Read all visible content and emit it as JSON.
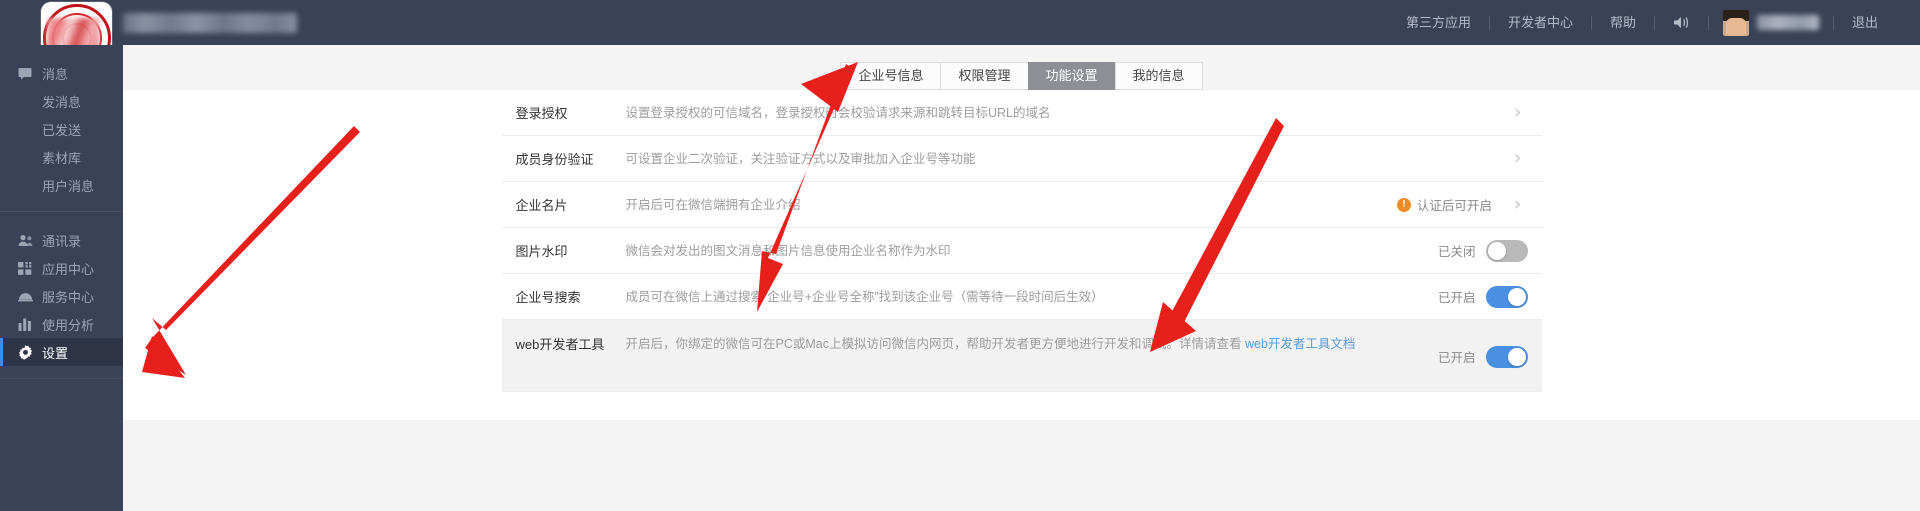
{
  "header": {
    "brand_title_redacted": "",
    "logo_alt": "company-seal-logo",
    "nav": [
      {
        "label": "第三方应用",
        "name": "nav-third-party-apps"
      },
      {
        "label": "开发者中心",
        "name": "nav-developer-center"
      },
      {
        "label": "帮助",
        "name": "nav-help"
      }
    ],
    "sound_icon": "speaker-icon",
    "user_name_redacted": "",
    "logout_label": "退出"
  },
  "sidebar": {
    "groups": [
      {
        "items": [
          {
            "label": "消息",
            "icon": "message-icon",
            "name": "sidebar-item-messages",
            "active": false
          }
        ],
        "subitems": [
          {
            "label": "发消息",
            "name": "sidebar-subitem-send-message"
          },
          {
            "label": "已发送",
            "name": "sidebar-subitem-sent"
          },
          {
            "label": "素材库",
            "name": "sidebar-subitem-material-library"
          },
          {
            "label": "用户消息",
            "name": "sidebar-subitem-user-messages"
          }
        ]
      },
      {
        "items": [
          {
            "label": "通讯录",
            "icon": "contacts-icon",
            "name": "sidebar-item-contacts",
            "active": false
          },
          {
            "label": "应用中心",
            "icon": "apps-grid-icon",
            "name": "sidebar-item-app-center",
            "active": false
          },
          {
            "label": "服务中心",
            "icon": "service-bell-icon",
            "name": "sidebar-item-service-center",
            "active": false
          },
          {
            "label": "使用分析",
            "icon": "bar-chart-icon",
            "name": "sidebar-item-analytics",
            "active": false
          },
          {
            "label": "设置",
            "icon": "gear-icon",
            "name": "sidebar-item-settings",
            "active": true
          }
        ],
        "subitems": []
      }
    ]
  },
  "tabs": [
    {
      "label": "企业号信息",
      "name": "tab-enterprise-info",
      "active": false
    },
    {
      "label": "权限管理",
      "name": "tab-permission-management",
      "active": false
    },
    {
      "label": "功能设置",
      "name": "tab-function-settings",
      "active": true
    },
    {
      "label": "我的信息",
      "name": "tab-my-info",
      "active": false
    }
  ],
  "settings_rows": [
    {
      "label": "登录授权",
      "desc": "设置登录授权的可信域名，登录授权时会校验请求来源和跳转目标URL的域名",
      "control": "chevron",
      "chevron": "›"
    },
    {
      "label": "成员身份验证",
      "desc": "可设置企业二次验证，关注验证方式以及审批加入企业号等功能",
      "control": "chevron",
      "chevron": "›"
    },
    {
      "label": "企业名片",
      "desc": "开启后可在微信端拥有企业介绍",
      "control": "warn-chevron",
      "warn_icon": "exclamation-icon",
      "warn_text": "认证后可开启",
      "chevron": "›"
    },
    {
      "label": "图片水印",
      "desc": "微信会对发出的图文消息和图片信息使用企业名称作为水印",
      "control": "toggle",
      "state_text": "已关闭",
      "toggle_on": false
    },
    {
      "label": "企业号搜索",
      "desc": "成员可在微信上通过搜索“企业号+企业号全称”找到该企业号（需等待一段时间后生效）",
      "control": "toggle",
      "state_text": "已开启",
      "toggle_on": true
    },
    {
      "label": "web开发者工具",
      "desc_part1": "开启后，你绑定的微信可在PC或Mac上模拟访问微信内网页，帮助开发者更方便地进行开发和调试。详情请查看 ",
      "desc_link": "web开发者工具文档",
      "control": "toggle",
      "state_text": "已开启",
      "toggle_on": true,
      "highlight": true
    }
  ],
  "colors": {
    "header_bg": "#3a4257",
    "toggle_on": "#4a90e2",
    "toggle_off": "#b9b9b9",
    "accent_blue": "#3a8ee6",
    "link_blue": "#5a9bd8",
    "warn_orange": "#ef8c28",
    "annotation_red": "#e8201c"
  }
}
